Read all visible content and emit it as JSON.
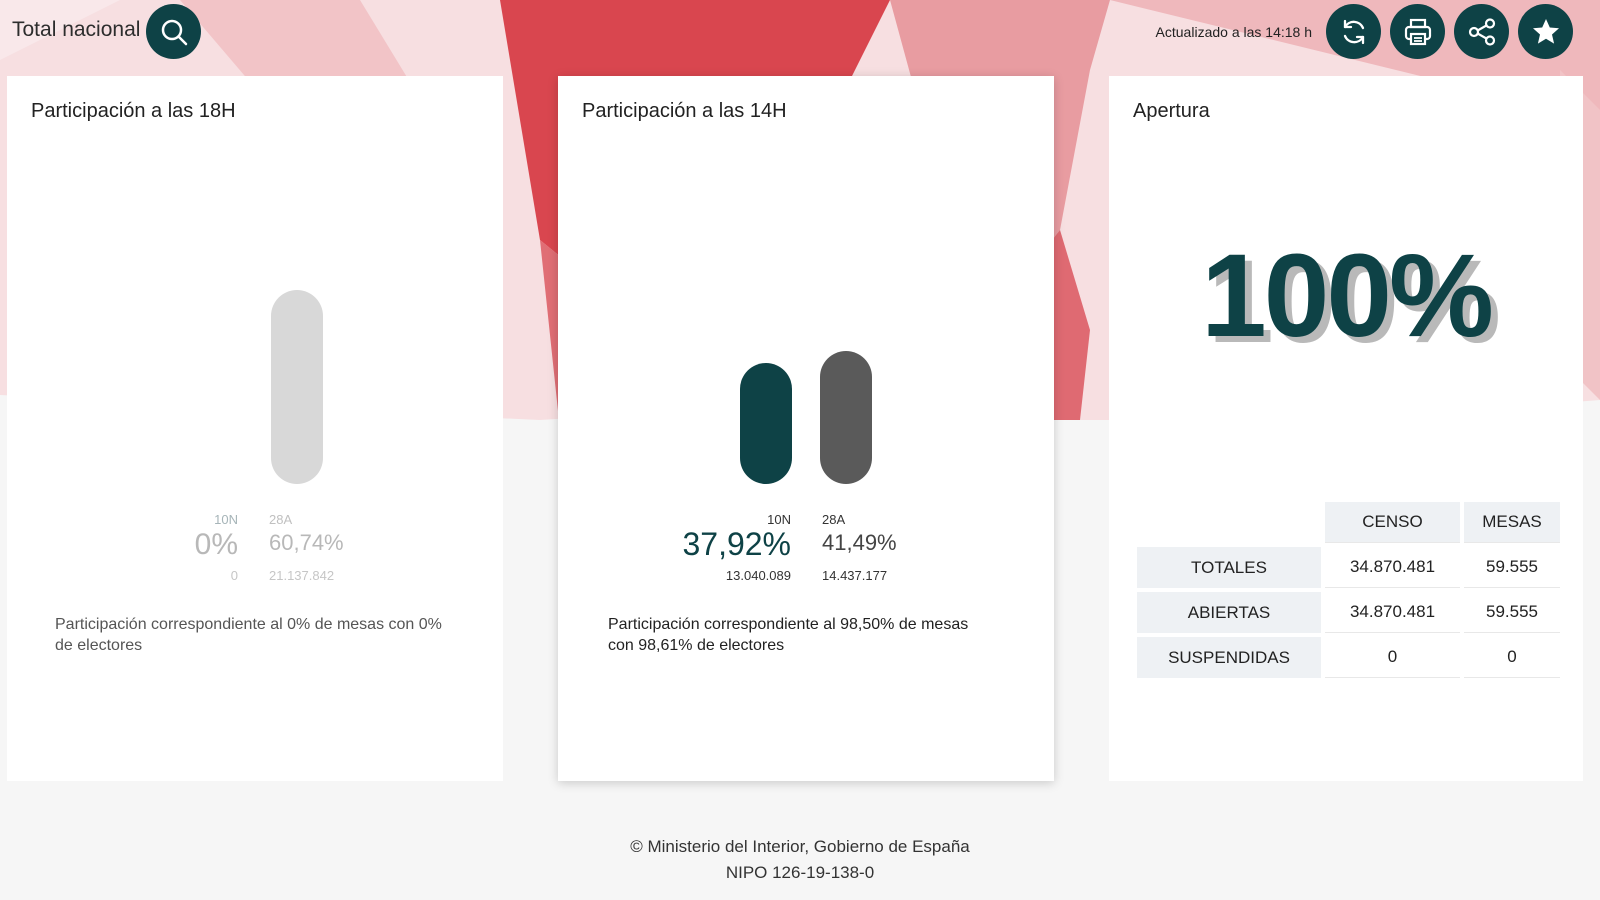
{
  "header": {
    "scope_label": "Total nacional",
    "updated_text": "Actualizado a las 14:18 h",
    "icons": [
      "search-icon",
      "refresh-icon",
      "print-icon",
      "share-icon",
      "star-icon"
    ]
  },
  "colors": {
    "primary": "#0e4246",
    "accent_red": "#d9464f",
    "bar_prev_active": "#5a5a5a",
    "bar_inactive": "#d8d8d8"
  },
  "cards": {
    "p18": {
      "title": "Participación a las 18H",
      "cur_label": "10N",
      "cur_pct": "0%",
      "cur_count": "0",
      "prev_label": "28A",
      "prev_pct": "60,74%",
      "prev_count": "21.137.842",
      "cur_fraction": 0,
      "prev_fraction": 0.6074,
      "note": "Participación correspondiente al 0% de mesas con 0% de electores"
    },
    "p14": {
      "title": "Participación a las 14H",
      "cur_label": "10N",
      "cur_pct": "37,92%",
      "cur_count": "13.040.089",
      "prev_label": "28A",
      "prev_pct": "41,49%",
      "prev_count": "14.437.177",
      "cur_fraction": 0.3792,
      "prev_fraction": 0.4149,
      "note": "Participación correspondiente al 98,50% de mesas con 98,61% de electores"
    },
    "apertura": {
      "title": "Apertura",
      "big_value": "100%",
      "table": {
        "headers": [
          "CENSO",
          "MESAS"
        ],
        "rows": [
          {
            "label": "TOTALES",
            "censo": "34.870.481",
            "mesas": "59.555"
          },
          {
            "label": "ABIERTAS",
            "censo": "34.870.481",
            "mesas": "59.555"
          },
          {
            "label": "SUSPENDIDAS",
            "censo": "0",
            "mesas": "0"
          }
        ]
      }
    }
  },
  "footer": {
    "line1": "© Ministerio del Interior, Gobierno de España",
    "line2": "NIPO 126-19-138-0"
  }
}
